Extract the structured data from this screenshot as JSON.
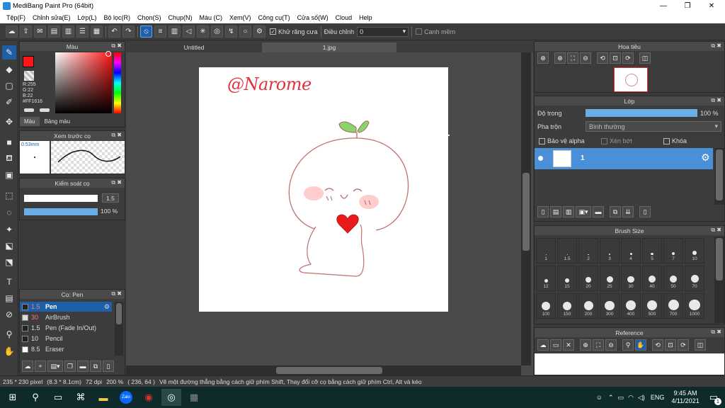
{
  "window": {
    "title": "MediBang Paint Pro (64bit)"
  },
  "menu": [
    "Tệp(F)",
    "Chỉnh sửa(E)",
    "Lớp(L)",
    "Bộ lọc(R)",
    "Chọn(S)",
    "Chụp(N)",
    "Màu (C)",
    "Xem(V)",
    "Công cụ(T)",
    "Cửa số(W)",
    "Cloud",
    "Help"
  ],
  "toolbar": {
    "antialias_label": "Khử răng cưa",
    "adjust_label": "Điều chỉnh",
    "adjust_value": "0",
    "snap_label": "Canh mềm"
  },
  "color_panel": {
    "title": "Màu",
    "r": "R:255",
    "g": "G:22",
    "b": "B:22",
    "hex": "#FF1616",
    "primary_color": "#ff1616",
    "tab_color": "Màu",
    "tab_palette": "Bảng màu"
  },
  "brush_preview": {
    "title": "Xem trước cọ",
    "size": "0.53mm"
  },
  "brush_control": {
    "title": "Kiểm soát cọ",
    "size_value": "1.5",
    "opacity_value": "100 %"
  },
  "brush_list": {
    "title": "Cọ: Pen",
    "items": [
      {
        "size": "1.5",
        "name": "Pen",
        "active": true
      },
      {
        "size": "30",
        "name": "AirBrush",
        "active": false
      },
      {
        "size": "1.5",
        "name": "Pen (Fade In/Out)",
        "active": false
      },
      {
        "size": "10",
        "name": "Pencil",
        "active": false
      },
      {
        "size": "8.5",
        "name": "Eraser",
        "active": false
      }
    ]
  },
  "documents": {
    "tab1": "Untitled",
    "tab2": "1.jpg"
  },
  "artwork": {
    "signature": "@Narome"
  },
  "navigator": {
    "title": "Hoa tiêu"
  },
  "layer_panel": {
    "title": "Lớp",
    "opacity_label": "Độ trong",
    "opacity_value": "100 %",
    "opacity_fraction": 1.0,
    "blend_label": "Pha trộn",
    "blend_value": "Bình thường",
    "protect_alpha": "Bảo vệ alpha",
    "clipping": "Xén bớt",
    "lock": "Khóa",
    "layer_name": "1"
  },
  "brush_size_panel": {
    "title": "Brush Size",
    "sizes": [
      "1",
      "1.5",
      "2",
      "3",
      "4",
      "5",
      "7",
      "10",
      "12",
      "15",
      "20",
      "25",
      "30",
      "40",
      "50",
      "70",
      "100",
      "150",
      "200",
      "300",
      "400",
      "500",
      "700",
      "1000"
    ]
  },
  "reference_panel": {
    "title": "Reference"
  },
  "status": {
    "size": "235 * 230 pixel",
    "cm": "(8.3 * 8.1cm)",
    "dpi": "72 dpi",
    "zoom": "200 %",
    "coords": "( 236, 64 )",
    "hint": "Vẽ một đường thẳng bằng cách giữ phím Shift, Thay đổi cỡ cọ bằng cách giữ phím Ctrl, Alt và kéo"
  },
  "taskbar": {
    "lang": "ENG",
    "time": "9:45 AM",
    "date": "4/11/2021",
    "notif_count": "1",
    "zalo": "Zalo"
  }
}
